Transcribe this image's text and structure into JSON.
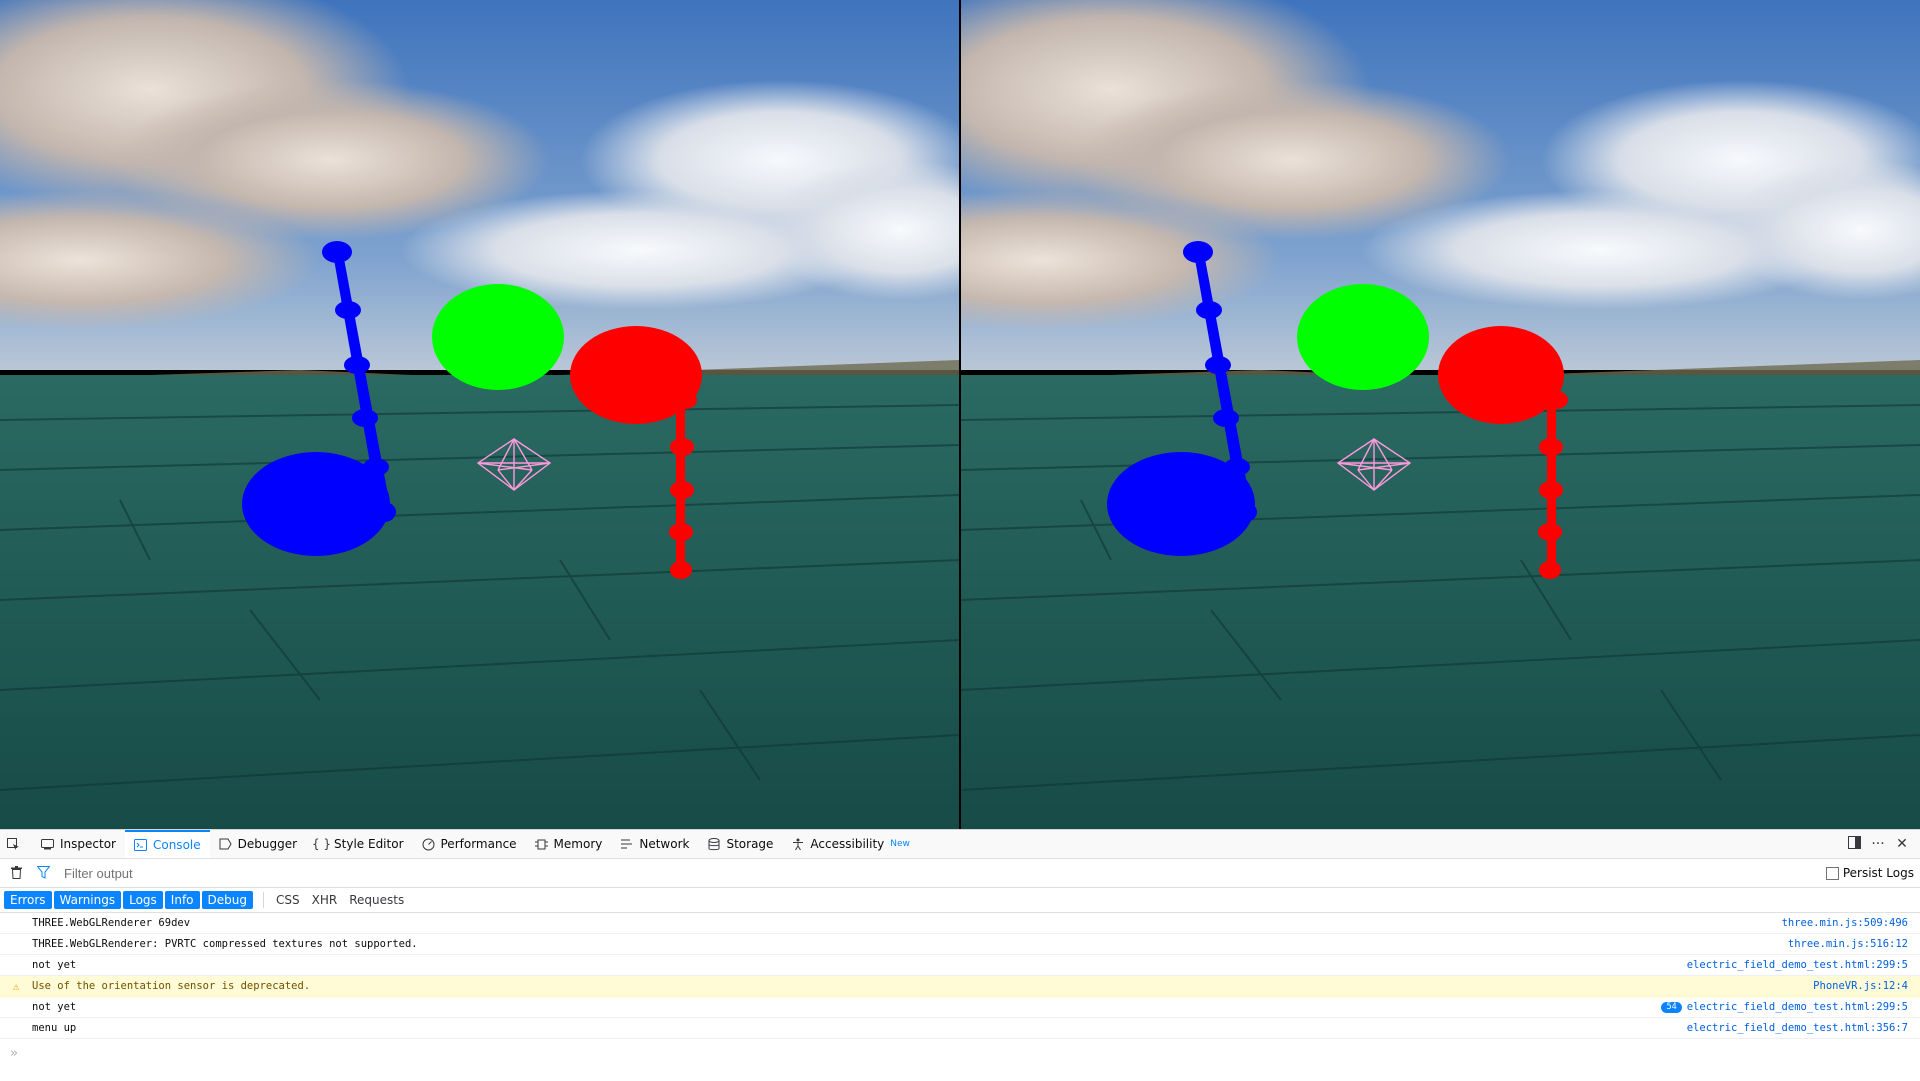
{
  "colors": {
    "sky_top": "#4d7fc4",
    "sky_horizon": "#a9bfd8",
    "floor": "#1d5d58",
    "floor_dark": "#123f3c",
    "sphere_blue": "#0000ff",
    "sphere_green": "#00ff00",
    "sphere_red": "#ff0000",
    "wireframe": "#ff99dd",
    "accent": "#0a84ff"
  },
  "devtools": {
    "tabs": [
      {
        "label": "Inspector",
        "icon": "inspector-icon",
        "selected": false
      },
      {
        "label": "Console",
        "icon": "console-icon",
        "selected": true
      },
      {
        "label": "Debugger",
        "icon": "debugger-icon",
        "selected": false
      },
      {
        "label": "Style Editor",
        "icon": "braces-icon",
        "selected": false
      },
      {
        "label": "Performance",
        "icon": "gauge-icon",
        "selected": false
      },
      {
        "label": "Memory",
        "icon": "memory-chip-icon",
        "selected": false
      },
      {
        "label": "Network",
        "icon": "network-icon",
        "selected": false
      },
      {
        "label": "Storage",
        "icon": "database-icon",
        "selected": false
      },
      {
        "label": "Accessibility",
        "icon": "accessibility-icon",
        "selected": false,
        "badge": "New"
      }
    ],
    "filter_placeholder": "Filter output",
    "persist_logs_label": "Persist Logs",
    "levels": [
      "Errors",
      "Warnings",
      "Logs",
      "Info",
      "Debug"
    ],
    "categories": [
      "CSS",
      "XHR",
      "Requests"
    ],
    "messages": [
      {
        "text": "THREE.WebGLRenderer 69dev",
        "source": "three.min.js:509:496",
        "type": "log"
      },
      {
        "text": "THREE.WebGLRenderer: PVRTC compressed textures not supported.",
        "source": "three.min.js:516:12",
        "type": "log"
      },
      {
        "text": "not yet",
        "source": "electric_field_demo_test.html:299:5",
        "type": "log"
      },
      {
        "text": "Use of the orientation sensor is deprecated.",
        "source": "PhoneVR.js:12:4",
        "type": "warn"
      },
      {
        "text": "not yet",
        "source": "electric_field_demo_test.html:299:5",
        "type": "log",
        "repeat": "54"
      },
      {
        "text": "menu up",
        "source": "electric_field_demo_test.html:356:7",
        "type": "log"
      }
    ],
    "prompt_symbol": "»"
  }
}
